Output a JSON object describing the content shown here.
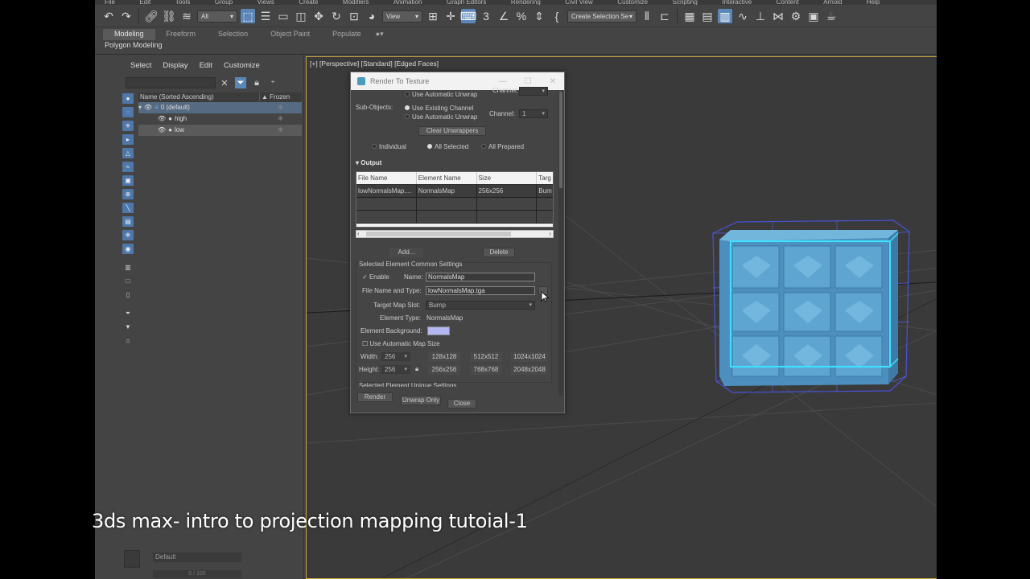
{
  "menu_bar": [
    "File",
    "Edit",
    "Tools",
    "Group",
    "Views",
    "Create",
    "Modifiers",
    "Animation",
    "Graph Editors",
    "Rendering",
    "Civil View",
    "Customize",
    "Scripting",
    "Interactive",
    "Content",
    "Arnold",
    "Help"
  ],
  "toolbar": {
    "filter_select": "All",
    "view_select": "View",
    "selection_set": "Create Selection Se"
  },
  "ribbon": {
    "tabs": [
      "Modeling",
      "Freeform",
      "Selection",
      "Object Paint",
      "Populate"
    ],
    "active_tab": "Modeling",
    "sub_label": "Polygon Modeling"
  },
  "scene_explorer": {
    "menu": [
      "Select",
      "Display",
      "Edit",
      "Customize"
    ],
    "col_name": "Name (Sorted Ascending)",
    "col_frozen": "▲ Frozen",
    "rows": [
      {
        "name": "0 (default)",
        "frozen": "❄"
      },
      {
        "name": "high",
        "frozen": "❄"
      },
      {
        "name": "low",
        "frozen": "❄"
      }
    ],
    "layer_field": "Default",
    "progress": "0 / 100"
  },
  "viewport": {
    "label": "[+] [Perspective] [Standard] [Edged Faces]"
  },
  "dialog": {
    "title": "Render To Texture",
    "use_auto_unwrap_top": "Use Automatic Unwrap",
    "channel_top": "Channel:",
    "sub_objects": "Sub-Objects:",
    "use_existing_channel": "Use Existing Channel",
    "use_auto_unwrap": "Use Automatic Unwrap",
    "channel_label": "Channel:",
    "channel_value": "1",
    "clear_unwrappers": "Clear Unwrappers",
    "mode_individual": "Individual",
    "mode_all_selected": "All Selected",
    "mode_all_prepared": "All Prepared",
    "output_section": "Output",
    "table_headers": [
      "File Name",
      "Element Name",
      "Size",
      "Targ"
    ],
    "table_rows": [
      [
        "lowNormalsMap....",
        "NormalsMap",
        "256x256",
        "Bum"
      ]
    ],
    "add_button": "Add...",
    "delete_button": "Delete",
    "common_settings": "Selected Element Common Settings",
    "enable_label": "Enable",
    "enable_check": "✓",
    "name_label": "Name:",
    "name_value": "NormalsMap",
    "file_type_label": "File Name and Type:",
    "file_type_value": "lowNormalsMap.tga",
    "target_slot_label": "Target Map Slot:",
    "target_slot_value": "Bump",
    "element_type_label": "Element Type:",
    "element_type_value": "NormalsMap",
    "element_bg_label": "Element Background:",
    "element_bg_color": "#b3b6f0",
    "auto_map_size": "Use Automatic Map Size",
    "width_label": "Width:",
    "width_value": "256",
    "height_label": "Height:",
    "height_value": "256",
    "size_presets_row1": [
      "128x128",
      "512x512",
      "1024x1024"
    ],
    "size_presets_row2": [
      "256x256",
      "768x768",
      "2048x2048"
    ],
    "unique_settings": "Selected Element Unique Settings",
    "render_button": "Render",
    "unwrap_only_button": "Unwrap Only",
    "close_button": "Close"
  },
  "caption": "3ds max- intro to projection mapping tutoial-1",
  "colors": {
    "accent_blue": "#5b87b8",
    "viewport_border": "#c9a441",
    "cube_fill": "#5a9ec9",
    "cube_highlight": "#3ee0ff",
    "wire_blue": "#4a52d8"
  }
}
